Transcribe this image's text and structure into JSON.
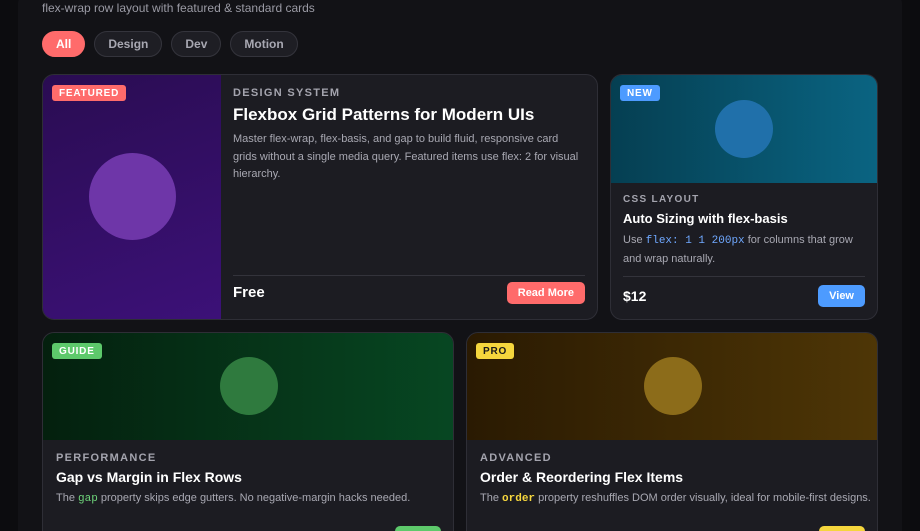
{
  "header": {
    "subtitle": "flex-wrap row layout with featured & standard cards"
  },
  "filters": [
    {
      "label": "All",
      "active": true
    },
    {
      "label": "Design",
      "active": false
    },
    {
      "label": "Dev",
      "active": false
    },
    {
      "label": "Motion",
      "active": false
    }
  ],
  "cards": [
    {
      "badge": "FEATURED",
      "category": "DESIGN SYSTEM",
      "title": "Flexbox Grid Patterns for Modern UIs",
      "description": "Master flex-wrap, flex-basis, and gap to build fluid, responsive card grids without a single media query. Featured items use flex: 2 for visual hierarchy.",
      "price": "Free",
      "button": "Read More",
      "accent": "#ff6b6b"
    },
    {
      "badge": "NEW",
      "category": "CSS LAYOUT",
      "title": "Auto Sizing with flex-basis",
      "description_pre": "Use ",
      "description_code": "flex: 1 1 200px",
      "description_post": " for columns that grow and wrap naturally.",
      "price": "$12",
      "button": "View",
      "accent": "#4d9bff"
    },
    {
      "badge": "GUIDE",
      "category": "PERFORMANCE",
      "title": "Gap vs Margin in Flex Rows",
      "description_pre": "The ",
      "description_code": "gap",
      "description_post": " property skips edge gutters. No negative-margin hacks needed.",
      "accent": "#5dc96b"
    },
    {
      "badge": "PRO",
      "category": "ADVANCED",
      "title": "Order & Reordering Flex Items",
      "description_pre": "The ",
      "description_code": "order",
      "description_post": " property reshuffles DOM order visually, ideal for mobile-first designs.",
      "accent": "#f5d63d"
    }
  ]
}
